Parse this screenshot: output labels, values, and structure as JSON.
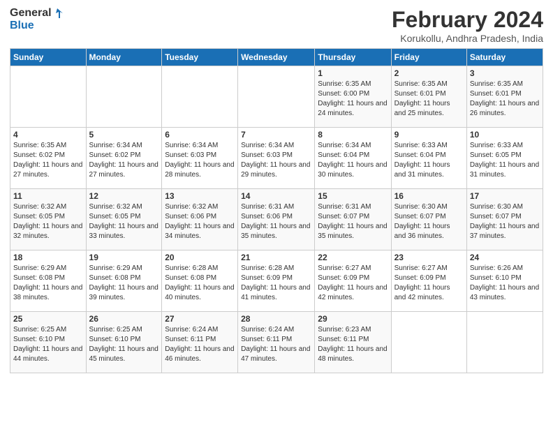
{
  "header": {
    "logo": {
      "general": "General",
      "blue": "Blue"
    },
    "title": "February 2024",
    "location": "Korukollu, Andhra Pradesh, India"
  },
  "days_of_week": [
    "Sunday",
    "Monday",
    "Tuesday",
    "Wednesday",
    "Thursday",
    "Friday",
    "Saturday"
  ],
  "weeks": [
    [
      {
        "day": "",
        "info": ""
      },
      {
        "day": "",
        "info": ""
      },
      {
        "day": "",
        "info": ""
      },
      {
        "day": "",
        "info": ""
      },
      {
        "day": "1",
        "info": "Sunrise: 6:35 AM\nSunset: 6:00 PM\nDaylight: 11 hours and 24 minutes."
      },
      {
        "day": "2",
        "info": "Sunrise: 6:35 AM\nSunset: 6:01 PM\nDaylight: 11 hours and 25 minutes."
      },
      {
        "day": "3",
        "info": "Sunrise: 6:35 AM\nSunset: 6:01 PM\nDaylight: 11 hours and 26 minutes."
      }
    ],
    [
      {
        "day": "4",
        "info": "Sunrise: 6:35 AM\nSunset: 6:02 PM\nDaylight: 11 hours and 27 minutes."
      },
      {
        "day": "5",
        "info": "Sunrise: 6:34 AM\nSunset: 6:02 PM\nDaylight: 11 hours and 27 minutes."
      },
      {
        "day": "6",
        "info": "Sunrise: 6:34 AM\nSunset: 6:03 PM\nDaylight: 11 hours and 28 minutes."
      },
      {
        "day": "7",
        "info": "Sunrise: 6:34 AM\nSunset: 6:03 PM\nDaylight: 11 hours and 29 minutes."
      },
      {
        "day": "8",
        "info": "Sunrise: 6:34 AM\nSunset: 6:04 PM\nDaylight: 11 hours and 30 minutes."
      },
      {
        "day": "9",
        "info": "Sunrise: 6:33 AM\nSunset: 6:04 PM\nDaylight: 11 hours and 31 minutes."
      },
      {
        "day": "10",
        "info": "Sunrise: 6:33 AM\nSunset: 6:05 PM\nDaylight: 11 hours and 31 minutes."
      }
    ],
    [
      {
        "day": "11",
        "info": "Sunrise: 6:32 AM\nSunset: 6:05 PM\nDaylight: 11 hours and 32 minutes."
      },
      {
        "day": "12",
        "info": "Sunrise: 6:32 AM\nSunset: 6:05 PM\nDaylight: 11 hours and 33 minutes."
      },
      {
        "day": "13",
        "info": "Sunrise: 6:32 AM\nSunset: 6:06 PM\nDaylight: 11 hours and 34 minutes."
      },
      {
        "day": "14",
        "info": "Sunrise: 6:31 AM\nSunset: 6:06 PM\nDaylight: 11 hours and 35 minutes."
      },
      {
        "day": "15",
        "info": "Sunrise: 6:31 AM\nSunset: 6:07 PM\nDaylight: 11 hours and 35 minutes."
      },
      {
        "day": "16",
        "info": "Sunrise: 6:30 AM\nSunset: 6:07 PM\nDaylight: 11 hours and 36 minutes."
      },
      {
        "day": "17",
        "info": "Sunrise: 6:30 AM\nSunset: 6:07 PM\nDaylight: 11 hours and 37 minutes."
      }
    ],
    [
      {
        "day": "18",
        "info": "Sunrise: 6:29 AM\nSunset: 6:08 PM\nDaylight: 11 hours and 38 minutes."
      },
      {
        "day": "19",
        "info": "Sunrise: 6:29 AM\nSunset: 6:08 PM\nDaylight: 11 hours and 39 minutes."
      },
      {
        "day": "20",
        "info": "Sunrise: 6:28 AM\nSunset: 6:08 PM\nDaylight: 11 hours and 40 minutes."
      },
      {
        "day": "21",
        "info": "Sunrise: 6:28 AM\nSunset: 6:09 PM\nDaylight: 11 hours and 41 minutes."
      },
      {
        "day": "22",
        "info": "Sunrise: 6:27 AM\nSunset: 6:09 PM\nDaylight: 11 hours and 42 minutes."
      },
      {
        "day": "23",
        "info": "Sunrise: 6:27 AM\nSunset: 6:09 PM\nDaylight: 11 hours and 42 minutes."
      },
      {
        "day": "24",
        "info": "Sunrise: 6:26 AM\nSunset: 6:10 PM\nDaylight: 11 hours and 43 minutes."
      }
    ],
    [
      {
        "day": "25",
        "info": "Sunrise: 6:25 AM\nSunset: 6:10 PM\nDaylight: 11 hours and 44 minutes."
      },
      {
        "day": "26",
        "info": "Sunrise: 6:25 AM\nSunset: 6:10 PM\nDaylight: 11 hours and 45 minutes."
      },
      {
        "day": "27",
        "info": "Sunrise: 6:24 AM\nSunset: 6:11 PM\nDaylight: 11 hours and 46 minutes."
      },
      {
        "day": "28",
        "info": "Sunrise: 6:24 AM\nSunset: 6:11 PM\nDaylight: 11 hours and 47 minutes."
      },
      {
        "day": "29",
        "info": "Sunrise: 6:23 AM\nSunset: 6:11 PM\nDaylight: 11 hours and 48 minutes."
      },
      {
        "day": "",
        "info": ""
      },
      {
        "day": "",
        "info": ""
      }
    ]
  ]
}
